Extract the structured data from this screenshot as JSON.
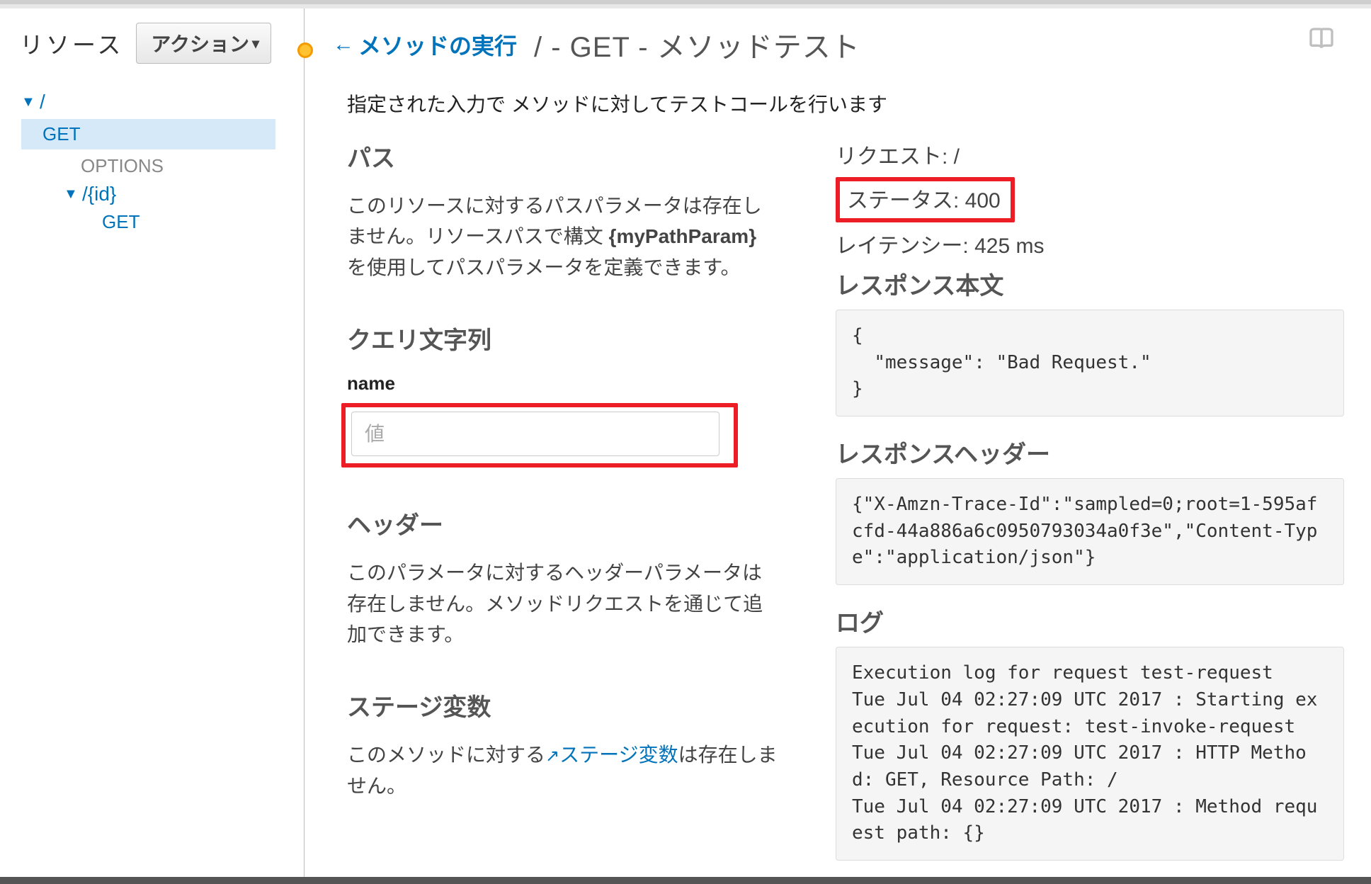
{
  "sidebar": {
    "title": "リソース",
    "actions_label": "アクション",
    "tree": {
      "root_label": "/",
      "root_get": "GET",
      "root_options": "OPTIONS",
      "id_label": "/{id}",
      "id_get": "GET"
    }
  },
  "header": {
    "back_label": "メソッドの実行",
    "title": "/ - GET - メソッドテスト"
  },
  "intro": "指定された入力で メソッドに対してテストコールを行います",
  "left": {
    "path_heading": "パス",
    "path_text_pre": "このリソースに対するパスパラメータは存在しません。リソースパスで構文 ",
    "path_text_bold": "{myPathParam}",
    "path_text_post": " を使用してパスパラメータを定義できます。",
    "query_heading": "クエリ文字列",
    "query_field_label": "name",
    "query_placeholder": "値",
    "headers_heading": "ヘッダー",
    "headers_text": "このパラメータに対するヘッダーパラメータは存在しません。メソッドリクエストを通じて追加できます。",
    "stage_heading": "ステージ変数",
    "stage_text_pre": "このメソッドに対する",
    "stage_link": "ステージ変数",
    "stage_text_post": "は存在しません。"
  },
  "right": {
    "request_line": "リクエスト: /",
    "status_line": "ステータス: 400",
    "latency_line": "レイテンシー: 425 ms",
    "resp_body_heading": "レスポンス本文",
    "resp_body": "{\n  \"message\": \"Bad Request.\"\n}",
    "resp_headers_heading": "レスポンスヘッダー",
    "resp_headers": "{\"X-Amzn-Trace-Id\":\"sampled=0;root=1-595afcfd-44a886a6c0950793034a0f3e\",\"Content-Type\":\"application/json\"}",
    "log_heading": "ログ",
    "log_body": "Execution log for request test-request\nTue Jul 04 02:27:09 UTC 2017 : Starting execution for request: test-invoke-request\nTue Jul 04 02:27:09 UTC 2017 : HTTP Method: GET, Resource Path: /\nTue Jul 04 02:27:09 UTC 2017 : Method request path: {}"
  }
}
